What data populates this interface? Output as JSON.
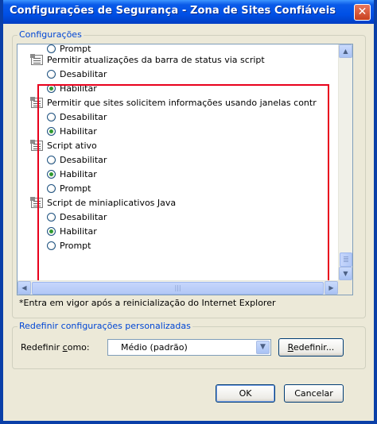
{
  "window": {
    "title": "Configurações de Segurança - Zona de Sites Confiáveis",
    "close_label": "✕"
  },
  "settings_group": {
    "label": "Configurações",
    "items": [
      {
        "kind": "radio",
        "label": "Prompt",
        "selected": false,
        "partial": true
      },
      {
        "kind": "setting",
        "label": "Permitir atualizações da barra de status via script"
      },
      {
        "kind": "radio",
        "label": "Desabilitar",
        "selected": false
      },
      {
        "kind": "radio",
        "label": "Habilitar",
        "selected": true
      },
      {
        "kind": "setting",
        "label": "Permitir que sites solicitem informações usando janelas contr"
      },
      {
        "kind": "radio",
        "label": "Desabilitar",
        "selected": false
      },
      {
        "kind": "radio",
        "label": "Habilitar",
        "selected": true
      },
      {
        "kind": "setting",
        "label": "Script ativo"
      },
      {
        "kind": "radio",
        "label": "Desabilitar",
        "selected": false
      },
      {
        "kind": "radio",
        "label": "Habilitar",
        "selected": true
      },
      {
        "kind": "radio",
        "label": "Prompt",
        "selected": false
      },
      {
        "kind": "setting",
        "label": "Script de miniaplicativos Java"
      },
      {
        "kind": "radio",
        "label": "Desabilitar",
        "selected": false
      },
      {
        "kind": "radio",
        "label": "Habilitar",
        "selected": true
      },
      {
        "kind": "radio",
        "label": "Prompt",
        "selected": false
      }
    ],
    "footnote": "*Entra em vigor após a reinicialização do Internet Explorer"
  },
  "reset_group": {
    "label": "Redefinir configurações personalizadas",
    "field_label": {
      "pre": "Redefinir ",
      "key": "c",
      "post": "omo:"
    },
    "combo_value": "Médio (padrão)",
    "button": {
      "key": "R",
      "post": "edefinir..."
    }
  },
  "footer": {
    "ok_label": "OK",
    "cancel_label": "Cancelar"
  },
  "colors": {
    "title_bar": "#0054e3",
    "group_label": "#0046d5",
    "highlight_frame": "#e8001c",
    "selected_radio": "#2f9a2f"
  }
}
